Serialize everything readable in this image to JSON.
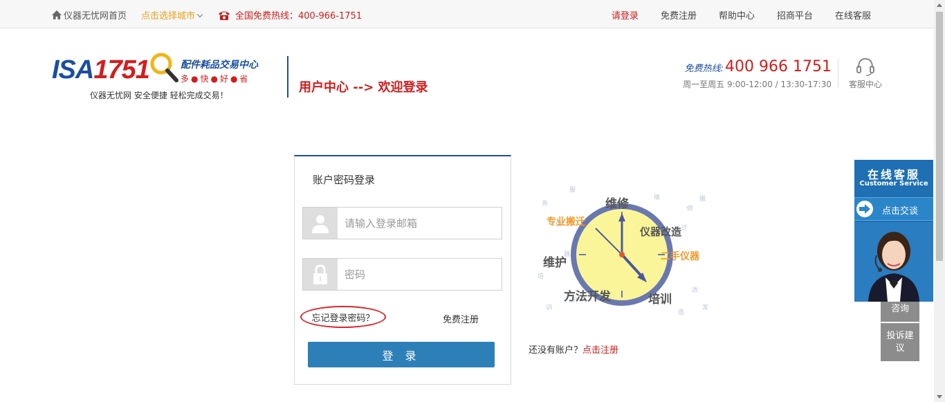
{
  "topbar": {
    "home": "仪器无忧网首页",
    "city": "点击选择城市",
    "hotline": "全国免费热线：400-966-1751",
    "links": {
      "login": "请登录",
      "register": "免费注册",
      "help": "帮助中心",
      "merchant": "招商平台",
      "online_service": "在线客服"
    }
  },
  "header": {
    "logo_part1": "ISA",
    "logo_part2": "1751",
    "logo_sub1": "配件耗品交易中心",
    "logo_sub2": "多●快●好●省",
    "slogan": "仪器无忧网 安全便捷 轻松完成交易！",
    "page_title": "用户中心 --> 欢迎登录",
    "hotline_label": "免费热线:",
    "hotline_number": "400 966 1751",
    "hours": "周一至周五 9:00-12:00 / 13:30-17:30",
    "service_center": "客服中心"
  },
  "login": {
    "title": "账户密码登录",
    "email_placeholder": "请输入登录邮箱",
    "password_placeholder": "密码",
    "forgot": "忘记登录密码？",
    "register": "免费注册",
    "submit": "登 录"
  },
  "illustration": {
    "words": [
      "维修",
      "专业搬迁",
      "仪器改造",
      "二手仪器",
      "维护",
      "方法开发",
      "培训"
    ]
  },
  "signup_prompt": {
    "text": "还没有账户？",
    "link": "点击注册"
  },
  "customer_service": {
    "title": "在线客服",
    "subtitle": "Customer Service",
    "chat": "点击交谈",
    "consult": "咨询",
    "complaint": "投诉建议"
  }
}
